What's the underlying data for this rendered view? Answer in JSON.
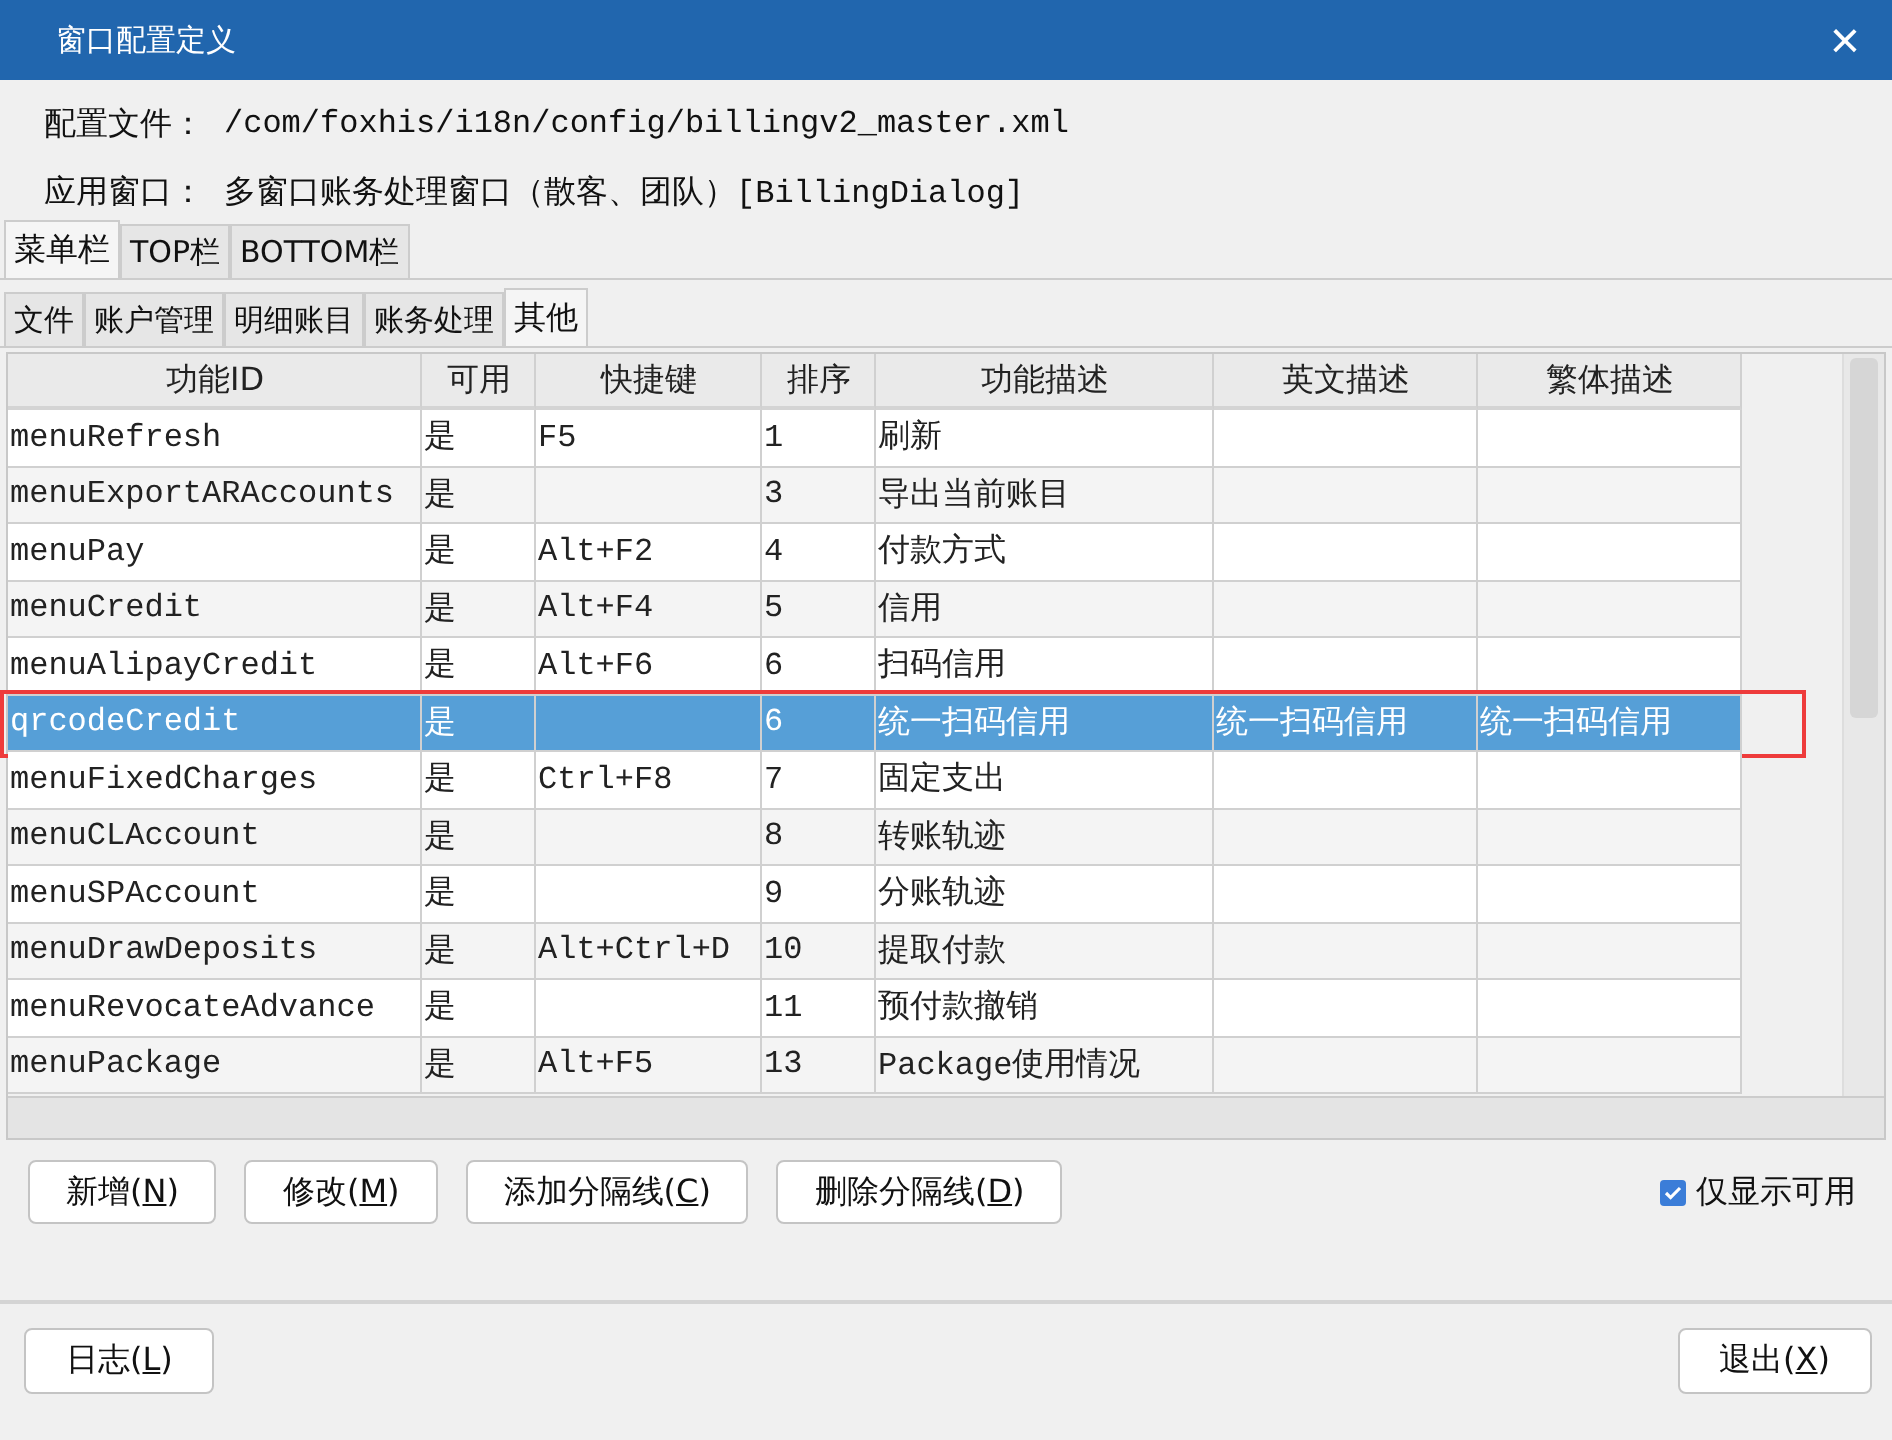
{
  "window": {
    "title": "窗口配置定义",
    "close": "×"
  },
  "info": [
    {
      "label": "配置文件：",
      "value": "/com/foxhis/i18n/config/billingv2_master.xml"
    },
    {
      "label": "应用窗口：",
      "value": "多窗口账务处理窗口（散客、团队）[BillingDialog]"
    }
  ],
  "tabs": [
    {
      "label": "菜单栏",
      "selected": true
    },
    {
      "label": "TOP栏",
      "selected": false
    },
    {
      "label": "BOTTOM栏",
      "selected": false
    }
  ],
  "subtabs": [
    {
      "label": "文件",
      "selected": false
    },
    {
      "label": "账户管理",
      "selected": false
    },
    {
      "label": "明细账目",
      "selected": false
    },
    {
      "label": "账务处理",
      "selected": false
    },
    {
      "label": "其他",
      "selected": true
    }
  ],
  "table": {
    "columns": [
      "功能ID",
      "可用",
      "快捷键",
      "排序",
      "功能描述",
      "英文描述",
      "繁体描述"
    ],
    "rows": [
      {
        "cells": [
          "menuRefresh",
          "是",
          "F5",
          "1",
          "刷新",
          "",
          ""
        ],
        "selected": false,
        "outlined": false
      },
      {
        "cells": [
          "menuExportARAccounts",
          "是",
          "",
          "3",
          "导出当前账目",
          "",
          ""
        ],
        "selected": false,
        "outlined": false
      },
      {
        "cells": [
          "menuPay",
          "是",
          "Alt+F2",
          "4",
          "付款方式",
          "",
          ""
        ],
        "selected": false,
        "outlined": false
      },
      {
        "cells": [
          "menuCredit",
          "是",
          "Alt+F4",
          "5",
          "信用",
          "",
          ""
        ],
        "selected": false,
        "outlined": false
      },
      {
        "cells": [
          "menuAlipayCredit",
          "是",
          "Alt+F6",
          "6",
          "扫码信用",
          "",
          ""
        ],
        "selected": false,
        "outlined": false
      },
      {
        "cells": [
          "qrcodeCredit",
          "是",
          "",
          "6",
          "统一扫码信用",
          "统一扫码信用",
          "统一扫码信用"
        ],
        "selected": true,
        "outlined": true
      },
      {
        "cells": [
          "menuFixedCharges",
          "是",
          "Ctrl+F8",
          "7",
          "固定支出",
          "",
          ""
        ],
        "selected": false,
        "outlined": false
      },
      {
        "cells": [
          "menuCLAccount",
          "是",
          "",
          "8",
          "转账轨迹",
          "",
          ""
        ],
        "selected": false,
        "outlined": false
      },
      {
        "cells": [
          "menuSPAccount",
          "是",
          "",
          "9",
          "分账轨迹",
          "",
          ""
        ],
        "selected": false,
        "outlined": false
      },
      {
        "cells": [
          "menuDrawDeposits",
          "是",
          "Alt+Ctrl+D",
          "10",
          "提取付款",
          "",
          ""
        ],
        "selected": false,
        "outlined": false
      },
      {
        "cells": [
          "menuRevocateAdvance",
          "是",
          "",
          "11",
          "预付款撤销",
          "",
          ""
        ],
        "selected": false,
        "outlined": false
      },
      {
        "cells": [
          "menuPackage",
          "是",
          "Alt+F5",
          "13",
          "Package使用情况",
          "",
          ""
        ],
        "selected": false,
        "outlined": false
      }
    ]
  },
  "actions": [
    {
      "before": "新增(",
      "key": "N",
      "after": ")"
    },
    {
      "before": "修改(",
      "key": "M",
      "after": ")"
    },
    {
      "before": "添加分隔线(",
      "key": "C",
      "after": ")"
    },
    {
      "before": "删除分隔线(",
      "key": "D",
      "after": ")"
    }
  ],
  "filter": {
    "label": "仅显示可用",
    "checked": true
  },
  "footer": [
    {
      "before": "日志(",
      "key": "L",
      "after": ")"
    },
    {
      "before": "退出(",
      "key": "X",
      "after": ")"
    }
  ]
}
